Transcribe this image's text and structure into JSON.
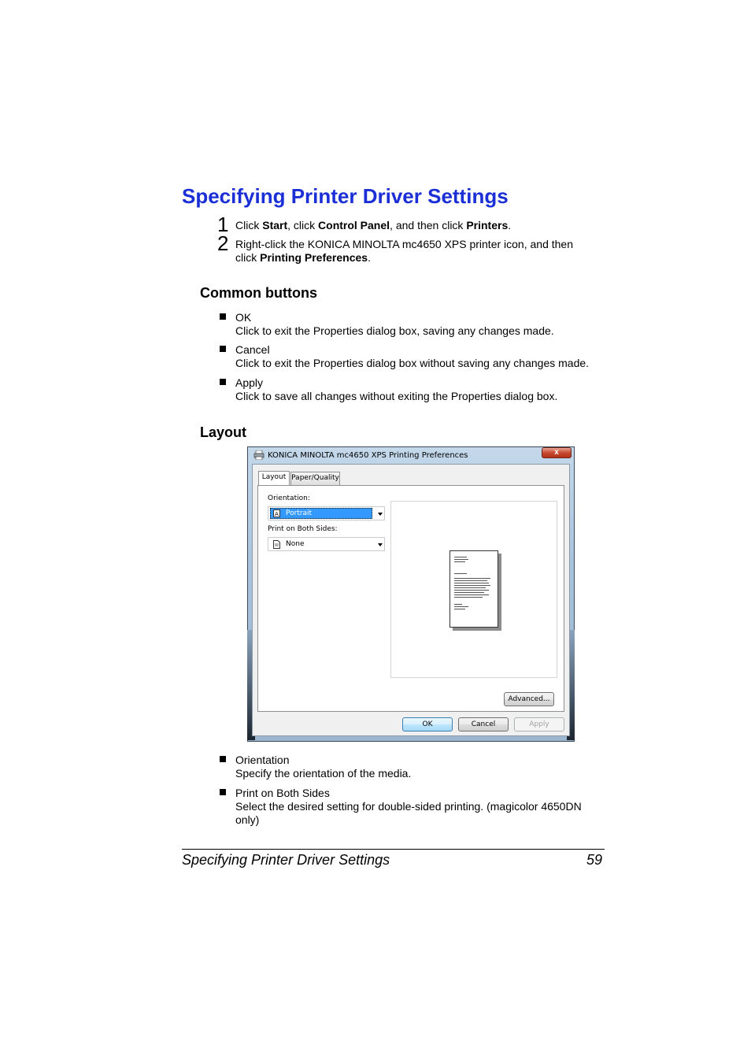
{
  "heading": "Specifying Printer Driver Settings",
  "steps": [
    {
      "num": "1",
      "parts": [
        "Click ",
        "Start",
        ", click ",
        "Control Panel",
        ", and then click ",
        "Printers",
        "."
      ]
    },
    {
      "num": "2",
      "line1": "Right-click the KONICA MINOLTA mc4650 XPS printer icon, and then",
      "line2_pre": "click ",
      "line2_bold": "Printing Preferences",
      "line2_post": "."
    }
  ],
  "common_buttons": {
    "title": "Common buttons",
    "items": [
      {
        "name": "OK",
        "desc": "Click to exit the Properties dialog box, saving any changes made."
      },
      {
        "name": "Cancel",
        "desc": "Click to exit the Properties dialog box without saving any changes made."
      },
      {
        "name": "Apply",
        "desc": "Click to save all changes without exiting the Properties dialog box."
      }
    ]
  },
  "layout_section": {
    "title": "Layout",
    "items": [
      {
        "name": "Orientation",
        "desc": "Specify the orientation of the media."
      },
      {
        "name": "Print on Both Sides",
        "desc1": "Select the desired setting for double-sided printing. (magicolor 4650DN",
        "desc2": "only)"
      }
    ]
  },
  "dialog": {
    "title": "KONICA MINOLTA mc4650 XPS Printing Preferences",
    "close": "x",
    "tabs": [
      "Layout",
      "Paper/Quality"
    ],
    "orientation_label": "Orientation:",
    "orientation_value": "Portrait",
    "both_sides_label": "Print on Both Sides:",
    "both_sides_value": "None",
    "advanced": "Advanced...",
    "ok": "OK",
    "cancel": "Cancel",
    "apply": "Apply"
  },
  "footer": {
    "title": "Specifying Printer Driver Settings",
    "page": "59"
  }
}
